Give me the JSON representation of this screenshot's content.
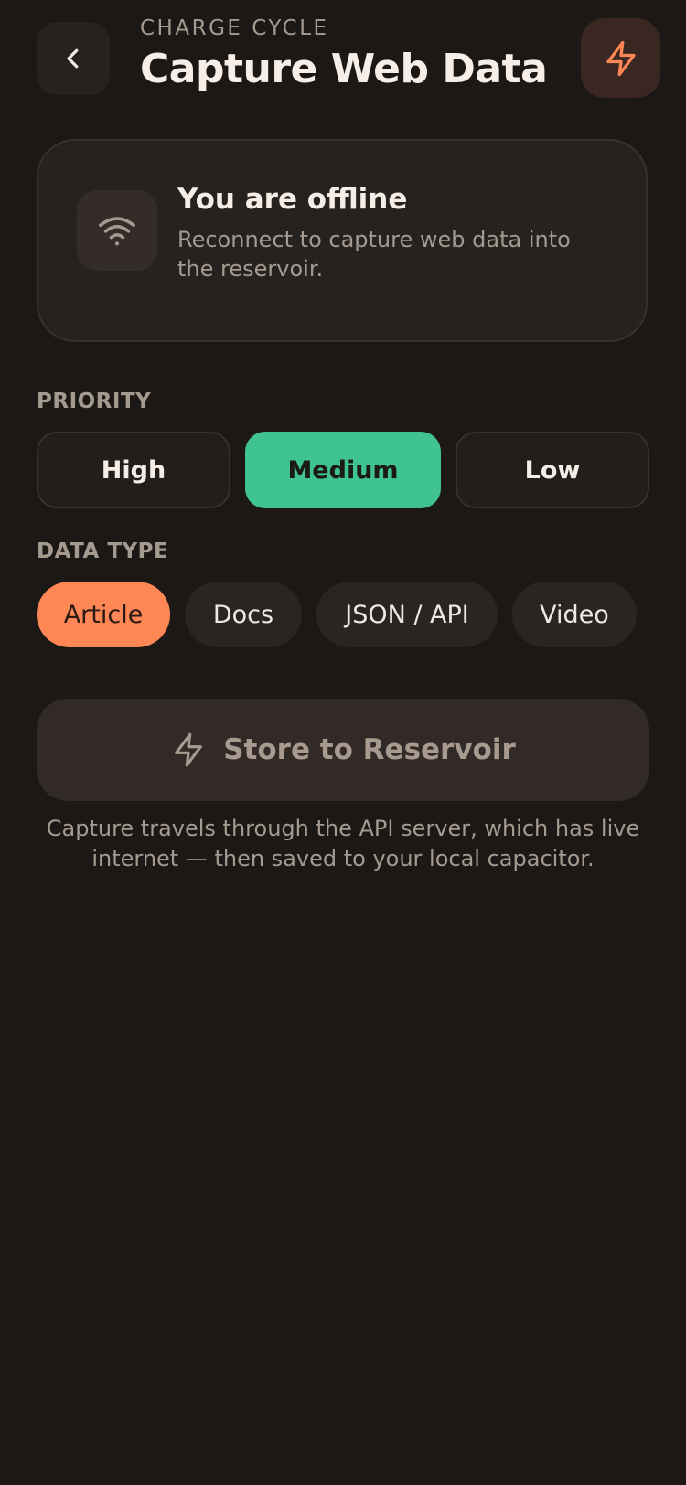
{
  "header": {
    "eyebrow": "CHARGE CYCLE",
    "title": "Capture Web Data",
    "back_icon": "chevron-left-icon",
    "action_icon": "bolt-icon"
  },
  "offline": {
    "icon": "wifi-icon",
    "title": "You are offline",
    "subtitle": "Reconnect to capture web data into the reservoir."
  },
  "priority": {
    "label": "PRIORITY",
    "options": [
      "High",
      "Medium",
      "Low"
    ],
    "selected": "Medium"
  },
  "data_type": {
    "label": "DATA TYPE",
    "options": [
      "Article",
      "Docs",
      "JSON / API",
      "Video"
    ],
    "selected": "Article"
  },
  "store": {
    "icon": "bolt-icon",
    "label": "Store to Reservoir"
  },
  "footnote": "Capture travels through the API server, which has live internet — then saved to your local capacitor.",
  "colors": {
    "background": "#1c1816",
    "accent_orange": "#ff8756",
    "accent_green": "#40c392",
    "muted_text": "#a59a90"
  }
}
